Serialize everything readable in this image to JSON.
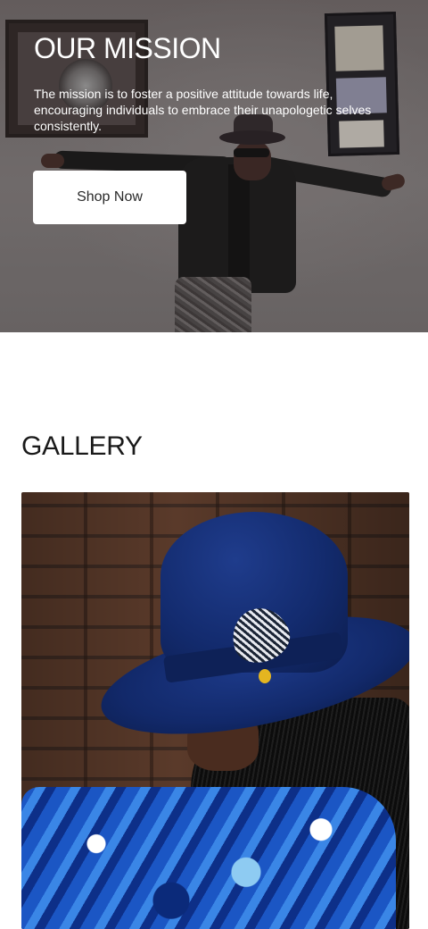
{
  "hero": {
    "title": "OUR MISSION",
    "description": "The mission is to foster a positive attitude towards life, encouraging individuals to embrace their unapologetic selves consistently.",
    "cta_label": "Shop Now"
  },
  "gallery": {
    "title": "GALLERY"
  }
}
